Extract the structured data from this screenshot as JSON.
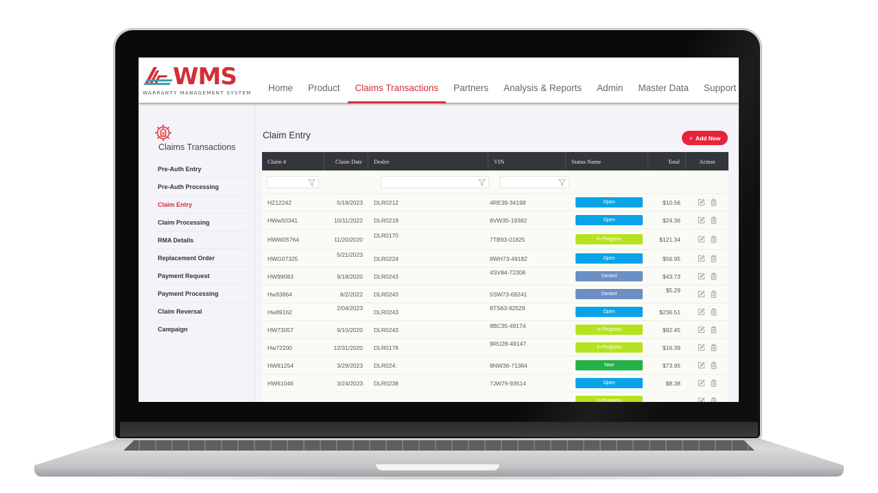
{
  "app": {
    "logo_text": "WMS",
    "logo_subtitle": "WARRANTY MANAGEMENT SYSTEM",
    "brand_color": "#d42d37",
    "logo_accent_color": "#3a9fb5"
  },
  "nav": {
    "items": [
      {
        "label": "Home",
        "active": false
      },
      {
        "label": "Product",
        "active": false
      },
      {
        "label": "Claims Transactions",
        "active": true
      },
      {
        "label": "Partners",
        "active": false
      },
      {
        "label": "Analysis & Reports",
        "active": false
      },
      {
        "label": "Admin",
        "active": false
      },
      {
        "label": "Master Data",
        "active": false
      },
      {
        "label": "Support",
        "active": false
      }
    ]
  },
  "sidebar": {
    "icon": "gear-document-icon",
    "title": "Claims Transactions",
    "items": [
      {
        "label": "Pre-Auth Entry",
        "active": false
      },
      {
        "label": "Pre-Auth Processing",
        "active": false
      },
      {
        "label": "Claim Entry",
        "active": true
      },
      {
        "label": "Claim Processing",
        "active": false
      },
      {
        "label": "RMA Details",
        "active": false
      },
      {
        "label": "Replacement Order",
        "active": false
      },
      {
        "label": "Payment Request",
        "active": false
      },
      {
        "label": "Payment Processing",
        "active": false
      },
      {
        "label": "Claim Reversal",
        "active": false
      },
      {
        "label": "Campaign",
        "active": false
      }
    ]
  },
  "main": {
    "title": "Claim Entry",
    "add_button": {
      "icon": "plus-icon",
      "label": "Add New"
    },
    "columns": {
      "claim": "Claim #",
      "date": "Claim Date",
      "dealer": "Dealer",
      "vin": "VIN",
      "status": "Status Name",
      "total": "Total",
      "action": "Action"
    },
    "filters": {
      "claim": {
        "value": "",
        "placeholder": ""
      },
      "dealer": {
        "value": "",
        "placeholder": ""
      },
      "vin": {
        "value": "",
        "placeholder": ""
      }
    },
    "status_colors": {
      "Open": "#0aa3e8",
      "In Progress": "#b5e31f",
      "Denied": "#6c8fc4",
      "New": "#26b24b"
    },
    "rows": [
      {
        "claim": "HZ12242",
        "date": "5/18/2023",
        "dealer": "DLR0212",
        "vin": "4RE39-34198",
        "status": "Open",
        "total": "$10.56"
      },
      {
        "claim": "HWw50341",
        "date": "10/11/2022",
        "dealer": "DLR0219",
        "vin": "8VW35-19382",
        "status": "Open",
        "total": "$24.36"
      },
      {
        "claim": "HWW05764",
        "date": "11/20/2020",
        "dealer": "DLR0170",
        "vin": "7TB93-01825",
        "status": "In Progress",
        "total": "$121.34"
      },
      {
        "claim": "HWG07325",
        "date": "5/21/2023",
        "dealer": "DLR0224",
        "vin": "8WH73-49182",
        "status": "Open",
        "total": "$56.95"
      },
      {
        "claim": "HW99083",
        "date": "9/18/2020",
        "dealer": "DLR0243",
        "vin": "4SV84-72308",
        "status": "Denied",
        "total": "$43.73"
      },
      {
        "claim": "Hw93864",
        "date": "8/2/2022",
        "dealer": "DLR0243",
        "vin": "5SW73-69241",
        "status": "Denied",
        "total": "$5.29"
      },
      {
        "claim": "Hw89162",
        "date": "2/04/2023",
        "dealer": "DLR0243",
        "vin": "8TS63-92529",
        "status": "Open",
        "total": "$236.51"
      },
      {
        "claim": "HW73057",
        "date": "9/10/2020",
        "dealer": "DLR0243",
        "vin": "8BC35-49174",
        "status": "In Progress",
        "total": "$92.45"
      },
      {
        "claim": "Hw72200",
        "date": "12/31/2020",
        "dealer": "DLR0178",
        "vin": "9RU28-49147",
        "status": "In Progress",
        "total": "$16.39"
      },
      {
        "claim": "HW61254",
        "date": "3/29/2023",
        "dealer": "DLR024:",
        "vin": "8NW36-71384",
        "status": "New",
        "total": "$73.95"
      },
      {
        "claim": "HW61046",
        "date": "3/24/2023",
        "dealer": "DLR0238",
        "vin": "7JW79-93514",
        "status": "Open",
        "total": "$8.38"
      },
      {
        "claim": "",
        "date": "",
        "dealer": "",
        "vin": "",
        "status": "In Progress",
        "total": ""
      }
    ],
    "row_actions": [
      "edit-icon",
      "delete-icon"
    ]
  }
}
